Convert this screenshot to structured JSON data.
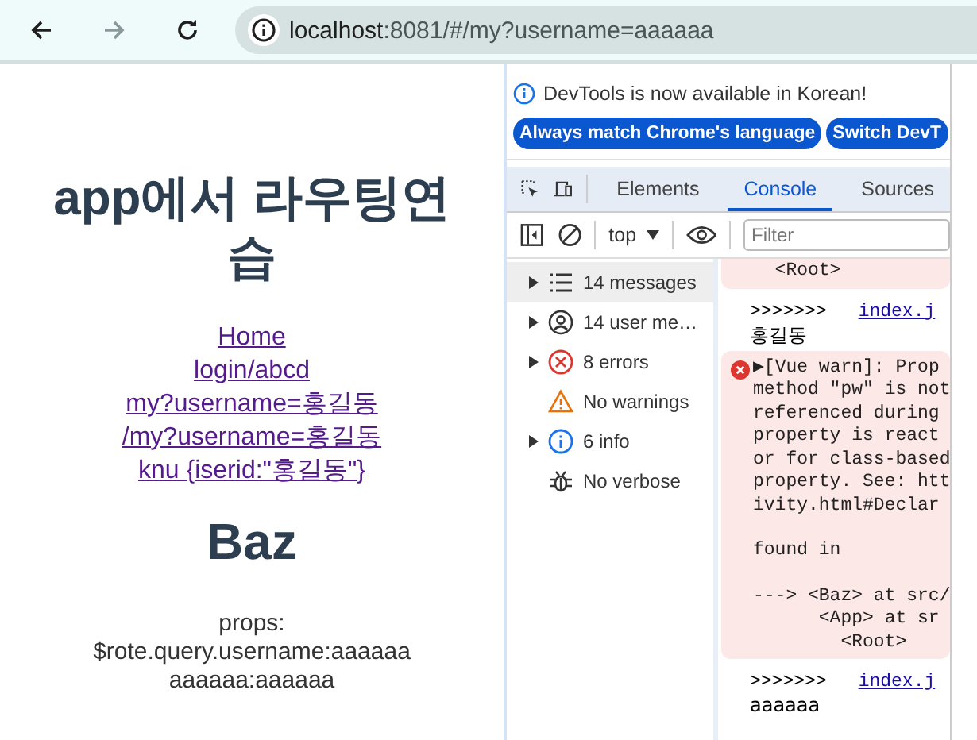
{
  "browser": {
    "url_host": "localhost",
    "url_rest": ":8081/#/my?username=aaaaaa"
  },
  "page": {
    "title": "app에서 라우팅연습",
    "links": [
      "Home",
      "login/abcd",
      "my?username=홍길동",
      "/my?username=홍길동",
      "knu {iserid:\"홍길동\"}"
    ],
    "heading": "Baz",
    "lines": [
      "props:",
      "$rote.query.username:aaaaaa",
      "aaaaaa:aaaaaa"
    ]
  },
  "devtools": {
    "notice": "DevTools is now available in Korean!",
    "buttons": [
      "Always match Chrome's language",
      "Switch DevT"
    ],
    "tabs": [
      {
        "label": "Elements",
        "selected": false
      },
      {
        "label": "Console",
        "selected": true
      },
      {
        "label": "Sources",
        "selected": false
      }
    ],
    "context": "top",
    "filter_placeholder": "Filter",
    "sidebar": [
      {
        "kind": "messages",
        "label": "14 messages",
        "expandable": true,
        "selected": true
      },
      {
        "kind": "user",
        "label": "14 user me…",
        "expandable": true,
        "selected": false
      },
      {
        "kind": "errors",
        "label": "8 errors",
        "expandable": true,
        "selected": false
      },
      {
        "kind": "warnings",
        "label": "No warnings",
        "expandable": false,
        "selected": false
      },
      {
        "kind": "info",
        "label": "6 info",
        "expandable": true,
        "selected": false
      },
      {
        "kind": "verbose",
        "label": "No verbose",
        "expandable": false,
        "selected": false
      }
    ],
    "messages": [
      {
        "kind": "error",
        "paragraphs": [
          [
            "  <Root>"
          ]
        ]
      },
      {
        "kind": "log",
        "prefix": ">>>>>>>",
        "source": "index.j",
        "lines": [
          "홍길동"
        ]
      },
      {
        "kind": "error",
        "paragraphs": [
          [
            "▶[Vue warn]: Prop",
            "method \"pw\" is not",
            "referenced during",
            "property is react",
            "or for class-based",
            "property. See: htt",
            "ivity.html#Declar"
          ],
          [
            "found in"
          ],
          [
            "---> <Baz> at src/",
            "      <App> at sr",
            "        <Root>"
          ]
        ]
      },
      {
        "kind": "log",
        "prefix": ">>>>>>>",
        "source": "index.j",
        "lines": [
          "aaaaaa"
        ]
      }
    ]
  }
}
